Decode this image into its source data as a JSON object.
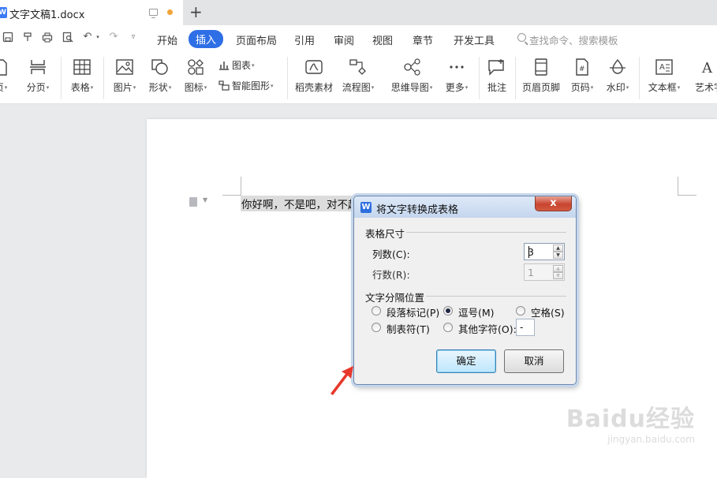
{
  "titlebar": {
    "doc_title": "文字文稿1.docx",
    "new_tab": "+"
  },
  "menubar": {
    "tabs": [
      {
        "label": "开始"
      },
      {
        "label": "插入"
      },
      {
        "label": "页面布局"
      },
      {
        "label": "引用"
      },
      {
        "label": "审阅"
      },
      {
        "label": "视图"
      },
      {
        "label": "章节"
      },
      {
        "label": "开发工具"
      }
    ],
    "active_tab": "插入",
    "search_placeholder": "查找命令、搜索模板"
  },
  "ribbon": {
    "items": [
      {
        "label": "页",
        "icon": "page-icon"
      },
      {
        "label": "分页",
        "icon": "page-break-icon"
      },
      {
        "label": "表格",
        "icon": "table-icon"
      },
      {
        "label": "图片",
        "icon": "picture-icon"
      },
      {
        "label": "形状",
        "icon": "shape-icon"
      },
      {
        "label": "图标",
        "icon": "icons-icon"
      },
      {
        "label": "稻壳素材",
        "icon": "docer-material-icon"
      },
      {
        "label": "流程图",
        "icon": "flowchart-icon"
      },
      {
        "label": "思维导图",
        "icon": "mindmap-icon"
      },
      {
        "label": "更多",
        "icon": "more-icon"
      },
      {
        "label": "批注",
        "icon": "comment-icon"
      },
      {
        "label": "页眉页脚",
        "icon": "header-footer-icon"
      },
      {
        "label": "页码",
        "icon": "page-number-icon"
      },
      {
        "label": "水印",
        "icon": "watermark-icon"
      },
      {
        "label": "文本框",
        "icon": "textbox-icon"
      },
      {
        "label": "艺术字",
        "icon": "wordart-icon"
      }
    ],
    "chart_label": "图表",
    "smart_graphic_label": "智能图形"
  },
  "document": {
    "selected_text": "你好啊，不是吧，对不起"
  },
  "dialog": {
    "title": "将文字转换成表格",
    "close_label": "x",
    "table_size_group": "表格尺寸",
    "columns_label": "列数(C):",
    "columns_value": "3",
    "rows_label": "行数(R):",
    "rows_value": "1",
    "separator_group": "文字分隔位置",
    "options": [
      {
        "label": "段落标记(P)",
        "checked": false
      },
      {
        "label": "逗号(M)",
        "checked": true
      },
      {
        "label": "空格(S)",
        "checked": false
      },
      {
        "label": "制表符(T)",
        "checked": false
      },
      {
        "label": "其他字符(O):",
        "checked": false
      }
    ],
    "other_char_value": "-",
    "ok_label": "确定",
    "cancel_label": "取消"
  },
  "watermark": {
    "brand": "Baidu经验",
    "url": "jingyan.baidu.com"
  },
  "colors": {
    "accent": "#2f6fe6",
    "annotation_arrow": "#e8382b"
  }
}
